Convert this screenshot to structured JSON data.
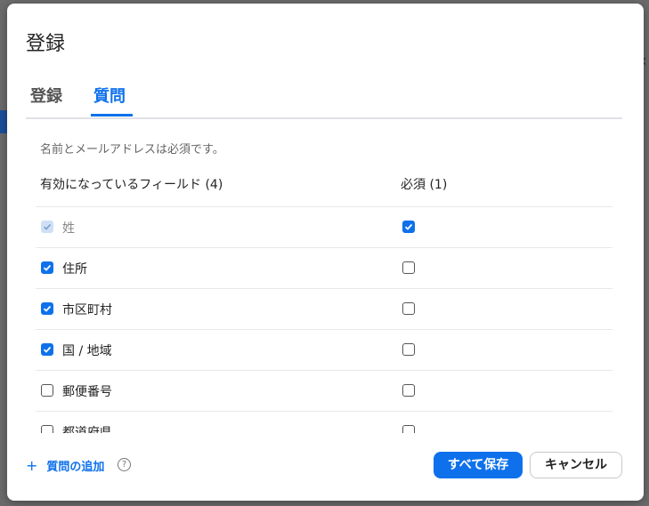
{
  "dialog": {
    "title": "登録",
    "tabs": [
      {
        "label": "登録",
        "active": false
      },
      {
        "label": "質問",
        "active": true
      }
    ],
    "note": "名前とメールアドレスは必須です。",
    "fields_header": "有効になっているフィールド (4)",
    "required_header": "必須 (1)",
    "fields": [
      {
        "label": "姓",
        "enabled": true,
        "enabled_disabled": true,
        "required": true
      },
      {
        "label": "住所",
        "enabled": true,
        "required": false
      },
      {
        "label": "市区町村",
        "enabled": true,
        "required": false
      },
      {
        "label": "国 / 地域",
        "enabled": true,
        "required": false
      },
      {
        "label": "郵便番号",
        "enabled": false,
        "required": false
      },
      {
        "label": "都道府県",
        "enabled": false,
        "required": false
      }
    ],
    "add_question": "質問の追加",
    "help_icon": "?",
    "save_button": "すべて保存",
    "cancel_button": "キャンセル"
  },
  "colors": {
    "accent": "#0e71eb",
    "disabled_check": "#cfe0f6"
  }
}
